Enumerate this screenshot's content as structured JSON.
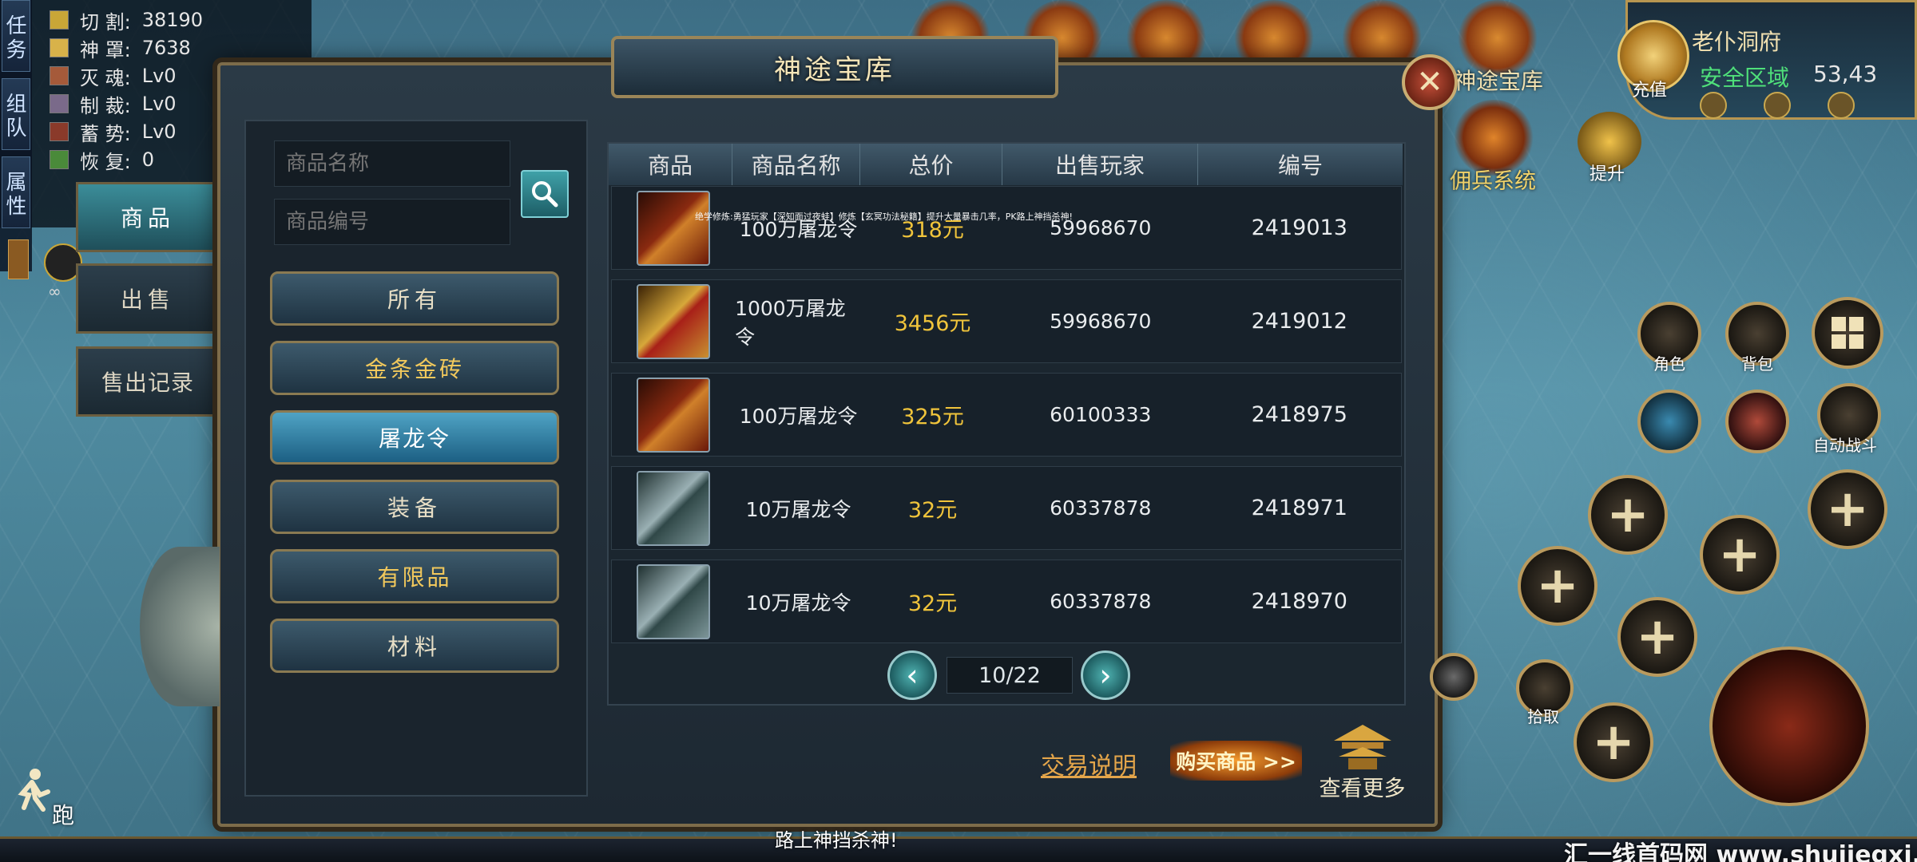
{
  "left_tabs": [
    "任务",
    "组队",
    "属性"
  ],
  "stats": [
    {
      "label": "切  割:",
      "value": "38190"
    },
    {
      "label": "神  罩:",
      "value": "7638"
    },
    {
      "label": "灭  魂:",
      "value": "Lv0"
    },
    {
      "label": "制  裁:",
      "value": "Lv0"
    },
    {
      "label": "蓄  势:",
      "value": "Lv0"
    },
    {
      "label": "恢  复:",
      "value": "0"
    }
  ],
  "infinity": "∞",
  "location": {
    "name": "老仆洞府",
    "zone": "安全区域",
    "coords": "53,43",
    "recharge": "充值"
  },
  "top_labels": {
    "mercenary": "佣兵系统",
    "upgrade": "提升",
    "partial": "神途宝库"
  },
  "window": {
    "title": "神途宝库",
    "close": "✕",
    "side_tabs": [
      "商品",
      "出售",
      "售出记录"
    ],
    "search": {
      "name_placeholder": "商品名称",
      "id_placeholder": "商品编号"
    },
    "categories": [
      "所有",
      "金条金砖",
      "屠龙令",
      "装备",
      "有限品",
      "材料"
    ],
    "table": {
      "headers": [
        "商品",
        "商品名称",
        "总价",
        "出售玩家",
        "编号"
      ],
      "rows": [
        {
          "icon": "red-dragon-token-icon",
          "name": "100万屠龙令",
          "price": "318元",
          "seller": "59968670",
          "id": "2419013"
        },
        {
          "icon": "gold-dragon-token-icon",
          "name": "1000万屠龙令",
          "price": "3456元",
          "seller": "59968670",
          "id": "2419012"
        },
        {
          "icon": "red-dragon-token-icon",
          "name": "100万屠龙令",
          "price": "325元",
          "seller": "60100333",
          "id": "2418975"
        },
        {
          "icon": "silver-dragon-token-icon",
          "name": "10万屠龙令",
          "price": "32元",
          "seller": "60337878",
          "id": "2418971"
        },
        {
          "icon": "silver-dragon-token-icon",
          "name": "10万屠龙令",
          "price": "32元",
          "seller": "60337878",
          "id": "2418970"
        }
      ]
    },
    "pager": {
      "prev": "‹",
      "page": "10/22",
      "next": "›"
    },
    "trade_info": "交易说明",
    "buy": "购买商品 >>",
    "more": "查看更多"
  },
  "marquee": "绝学修炼:勇猛玩家【深知面过夜蛙】修炼【玄冥功法秘籍】提升大量暴击几率，PK路上神挡杀神!",
  "hud": {
    "role": "角色",
    "bag": "背包",
    "auto": "自动战斗",
    "pickup": "拾取",
    "plus": "+",
    "run": "跑"
  },
  "bottom_text": "路上神挡杀神!",
  "watermark": "汇一线首码网 www.shujiegxi.com"
}
